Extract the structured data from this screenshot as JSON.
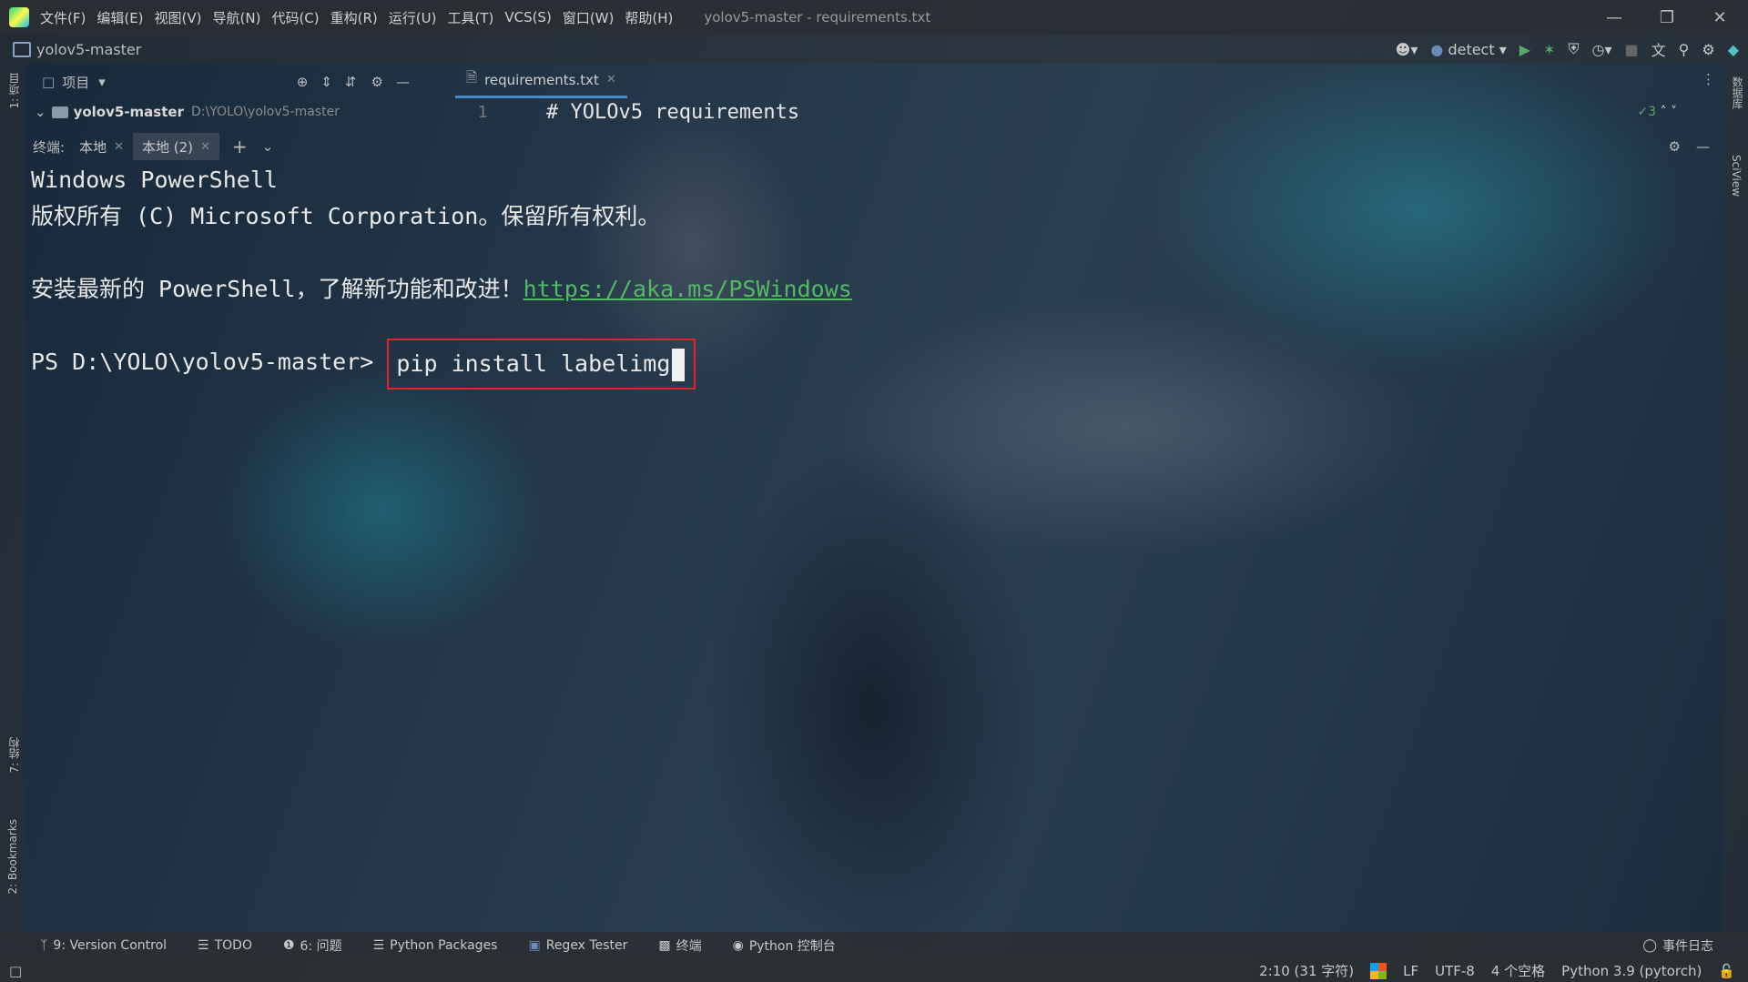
{
  "title_bar": {
    "menus": [
      "文件(F)",
      "编辑(E)",
      "视图(V)",
      "导航(N)",
      "代码(C)",
      "重构(R)",
      "运行(U)",
      "工具(T)",
      "VCS(S)",
      "窗口(W)",
      "帮助(H)"
    ],
    "window_title": "yolov5-master - requirements.txt"
  },
  "nav": {
    "breadcrumb": "yolov5-master",
    "run_config": "detect"
  },
  "project": {
    "header_label": "项目",
    "root_name": "yolov5-master",
    "root_path": "D:\\YOLO\\yolov5-master"
  },
  "left_strip": {
    "project_label": "1: 项目",
    "structure_label": "7: 结构",
    "bookmarks_label": "2: Bookmarks"
  },
  "right_strip": {
    "database_label": "数据库",
    "sciview_label": "SciView"
  },
  "editor": {
    "tab_label": "requirements.txt",
    "line_number": "1",
    "code_line": "# YOLOv5 requirements",
    "inspection_count": "3"
  },
  "terminal": {
    "tabs_label": "终端:",
    "tabs": [
      "本地",
      "本地 (2)"
    ],
    "lines": [
      "Windows PowerShell",
      "版权所有 (C) Microsoft Corporation。保留所有权利。",
      "",
      "安装最新的 PowerShell，了解新功能和改进！"
    ],
    "link": "https://aka.ms/PSWindows",
    "prompt": "PS D:\\YOLO\\yolov5-master>",
    "command": "pip install labelimg"
  },
  "bottom_tools": {
    "version_control": "9: Version Control",
    "todo": "TODO",
    "problems": "6: 问题",
    "python_packages": "Python Packages",
    "regex_tester": "Regex Tester",
    "terminal": "终端",
    "python_console": "Python 控制台",
    "event_log": "事件日志"
  },
  "status": {
    "position": "2:10 (31 字符)",
    "line_sep": "LF",
    "encoding": "UTF-8",
    "indent": "4 个空格",
    "interpreter": "Python 3.9 (pytorch)"
  },
  "colors": {
    "accent": "#4a88c7",
    "link": "#54b865",
    "highlight_box": "#e0242e"
  }
}
